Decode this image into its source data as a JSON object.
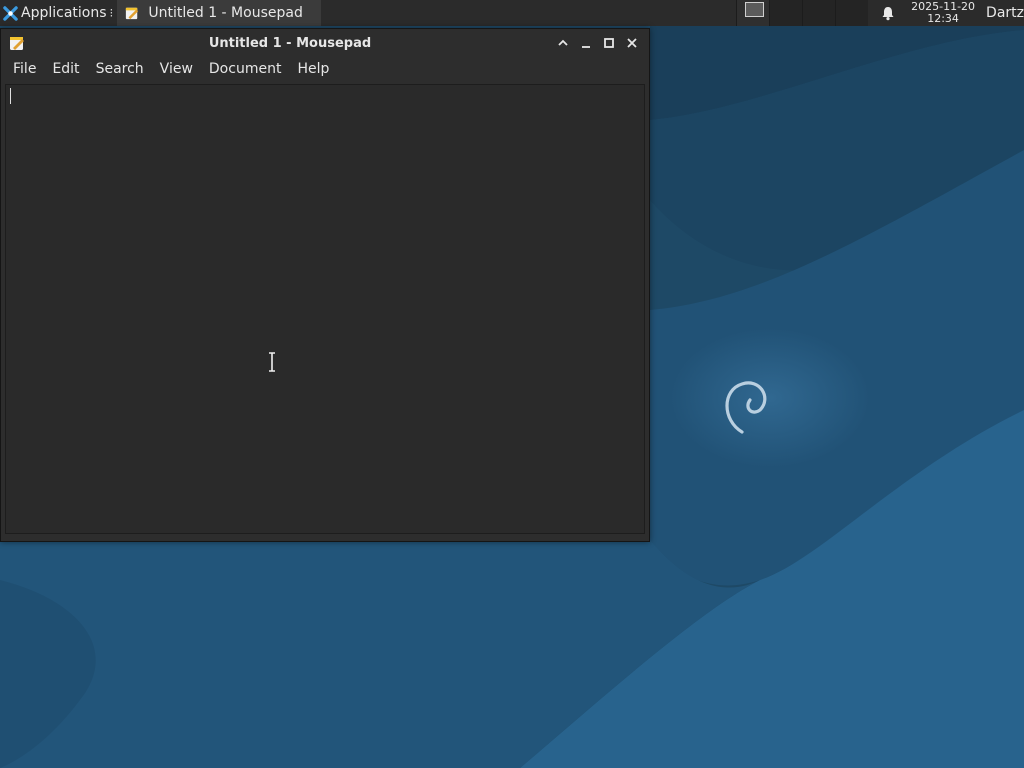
{
  "panel": {
    "applications_label": "Applications",
    "applications_icon": "xfce-mouse-icon",
    "menu_dots": "⁝",
    "task_title": "Untitled 1 - Mousepad",
    "clock_date": "2025-11-20",
    "clock_time": "12:34",
    "username": "Dartz"
  },
  "window": {
    "title": "Untitled 1 - Mousepad",
    "menu": [
      "File",
      "Edit",
      "Search",
      "View",
      "Document",
      "Help"
    ],
    "editor_text": ""
  },
  "colors": {
    "panel_bg": "#2b2b2b",
    "window_bg": "#2d2d2d",
    "editor_bg": "#2a2a2a",
    "desktop_bg": "#1f4b6a",
    "accent_blue": "#2f6f9a"
  }
}
